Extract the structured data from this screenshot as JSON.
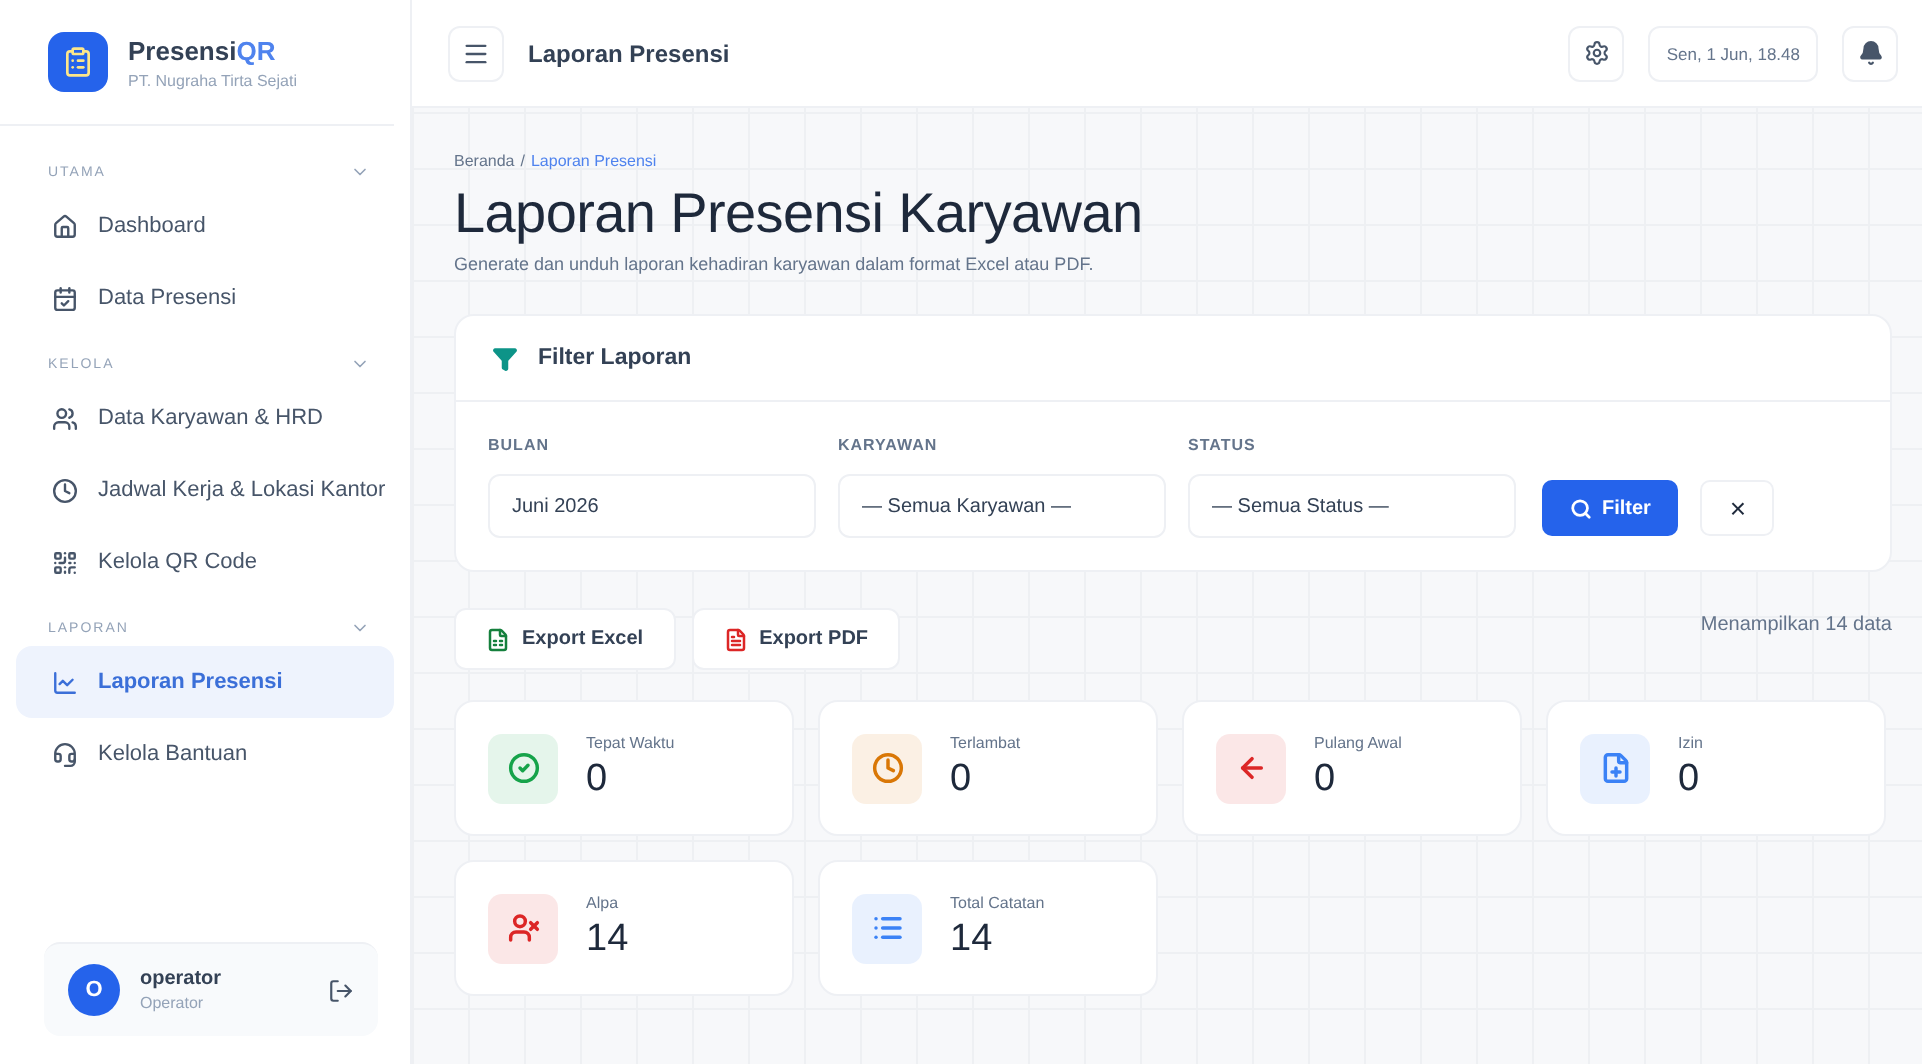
{
  "brand": {
    "name": "Presensi",
    "accent": "QR",
    "company": "PT. Nugraha Tirta Sejati"
  },
  "sidebar": {
    "sections": [
      {
        "title": "UTAMA",
        "items": [
          {
            "label": "Dashboard",
            "kind": "home",
            "selected": false
          },
          {
            "label": "Data Presensi",
            "kind": "calendar",
            "selected": false
          }
        ]
      },
      {
        "title": "KELOLA",
        "items": [
          {
            "label": "Data Karyawan & HRD",
            "kind": "users",
            "selected": false
          },
          {
            "label": "Jadwal Kerja & Lokasi Kantor",
            "kind": "clock",
            "selected": false
          },
          {
            "label": "Kelola QR Code",
            "kind": "qr",
            "selected": false
          }
        ]
      },
      {
        "title": "LAPORAN",
        "items": [
          {
            "label": "Laporan Presensi",
            "kind": "chart",
            "selected": true
          },
          {
            "label": "Kelola Bantuan",
            "kind": "headset",
            "selected": false
          }
        ]
      }
    ],
    "user": {
      "initial": "O",
      "name": "operator",
      "role": "Operator"
    }
  },
  "topbar": {
    "title": "Laporan Presensi",
    "datetime": "Sen, 1 Jun, 18.48"
  },
  "breadcrumb": {
    "separator": "/",
    "items": [
      {
        "label": "Beranda",
        "current": false
      },
      {
        "label": "Laporan Presensi",
        "current": true
      }
    ]
  },
  "page": {
    "title": "Laporan Presensi Karyawan",
    "subtitle": "Generate dan unduh laporan kehadiran karyawan dalam format Excel atau PDF."
  },
  "filter": {
    "title": "Filter Laporan",
    "fields": [
      {
        "label": "BULAN",
        "value": "Juni 2026"
      },
      {
        "label": "KARYAWAN",
        "value": "— Semua Karyawan —"
      },
      {
        "label": "STATUS",
        "value": "— Semua Status —"
      }
    ],
    "submit": "Filter",
    "clear": "×"
  },
  "exports": [
    {
      "label": "Export Excel",
      "kind": "excel"
    },
    {
      "label": "Export PDF",
      "kind": "pdf"
    }
  ],
  "count_text": "Menampilkan 14 data",
  "stats": [
    {
      "label": "Tepat Waktu",
      "value": "0",
      "kind": "check",
      "color": "#16a34a"
    },
    {
      "label": "Terlambat",
      "value": "0",
      "kind": "clock",
      "color": "#d97706"
    },
    {
      "label": "Pulang Awal",
      "value": "0",
      "kind": "arrow",
      "color": "#dc2626"
    },
    {
      "label": "Izin",
      "value": "0",
      "kind": "file",
      "color": "#3b82f6"
    },
    {
      "label": "Alpa",
      "value": "14",
      "kind": "userx",
      "color": "#dc2626"
    },
    {
      "label": "Total Catatan",
      "value": "14",
      "kind": "list",
      "color": "#3b82f6"
    }
  ]
}
